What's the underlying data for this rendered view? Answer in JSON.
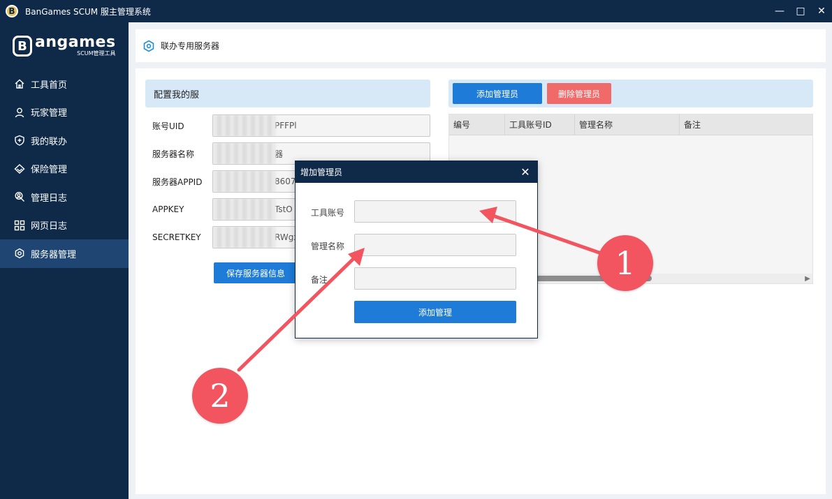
{
  "window": {
    "logo_letter": "B",
    "title": "BanGames SCUM 服主管理系统",
    "minimize_glyph": "—",
    "maximize_glyph": "□",
    "close_glyph": "✕"
  },
  "brand": {
    "mark": "B",
    "name": "angames",
    "subtitle": "SCUM管理工具"
  },
  "sidebar": {
    "items": [
      {
        "label": "工具首页",
        "icon": "home-icon"
      },
      {
        "label": "玩家管理",
        "icon": "user-icon"
      },
      {
        "label": "我的联办",
        "icon": "shield-plus-icon"
      },
      {
        "label": "保险管理",
        "icon": "diamond-icon"
      },
      {
        "label": "管理日志",
        "icon": "person-search-icon"
      },
      {
        "label": "网页日志",
        "icon": "grid-icon"
      },
      {
        "label": "服务器管理",
        "icon": "target-icon",
        "active": true
      }
    ]
  },
  "header": {
    "title": "联办专用服务器"
  },
  "config": {
    "title": "配置我的服",
    "fields": [
      {
        "label": "账号UID",
        "value_suffix": "PFFPl"
      },
      {
        "label": "服务器名称",
        "value_suffix": "器"
      },
      {
        "label": "服务器APPID",
        "value_suffix": "8607"
      },
      {
        "label": "APPKEY",
        "value_suffix": "TstO"
      },
      {
        "label": "SECRETKEY",
        "value_suffix": "RWgx"
      }
    ],
    "save_label": "保存服务器信息"
  },
  "admin": {
    "add_label": "添加管理员",
    "delete_label": "删除管理员",
    "columns": [
      "编号",
      "工具账号ID",
      "管理名称",
      "备注"
    ]
  },
  "dialog": {
    "title": "增加管理员",
    "close_glyph": "✕",
    "fields": [
      {
        "label": "工具账号"
      },
      {
        "label": "管理名称"
      },
      {
        "label": "备注"
      }
    ],
    "submit_label": "添加管理"
  },
  "annotations": {
    "badge_1": "1",
    "badge_2": "2",
    "color": "#f25460"
  }
}
